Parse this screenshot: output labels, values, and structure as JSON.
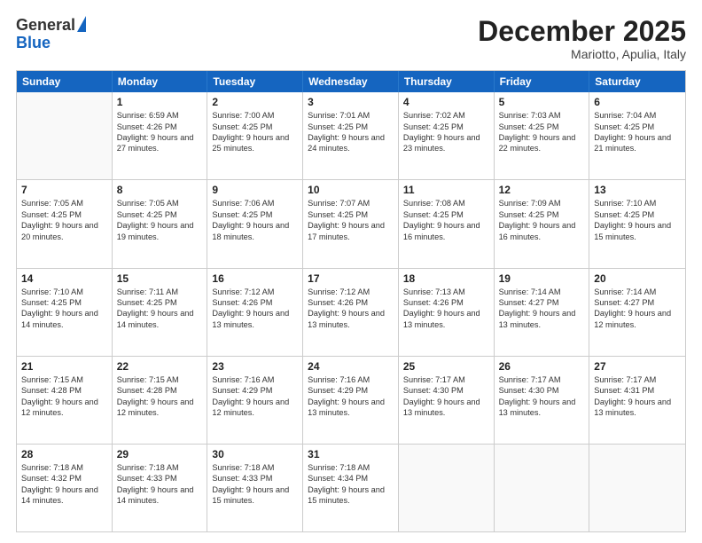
{
  "logo": {
    "general": "General",
    "blue": "Blue"
  },
  "header": {
    "month": "December 2025",
    "location": "Mariotto, Apulia, Italy"
  },
  "weekdays": [
    "Sunday",
    "Monday",
    "Tuesday",
    "Wednesday",
    "Thursday",
    "Friday",
    "Saturday"
  ],
  "rows": [
    [
      {
        "day": "",
        "sunrise": "",
        "sunset": "",
        "daylight": ""
      },
      {
        "day": "1",
        "sunrise": "Sunrise: 6:59 AM",
        "sunset": "Sunset: 4:26 PM",
        "daylight": "Daylight: 9 hours and 27 minutes."
      },
      {
        "day": "2",
        "sunrise": "Sunrise: 7:00 AM",
        "sunset": "Sunset: 4:25 PM",
        "daylight": "Daylight: 9 hours and 25 minutes."
      },
      {
        "day": "3",
        "sunrise": "Sunrise: 7:01 AM",
        "sunset": "Sunset: 4:25 PM",
        "daylight": "Daylight: 9 hours and 24 minutes."
      },
      {
        "day": "4",
        "sunrise": "Sunrise: 7:02 AM",
        "sunset": "Sunset: 4:25 PM",
        "daylight": "Daylight: 9 hours and 23 minutes."
      },
      {
        "day": "5",
        "sunrise": "Sunrise: 7:03 AM",
        "sunset": "Sunset: 4:25 PM",
        "daylight": "Daylight: 9 hours and 22 minutes."
      },
      {
        "day": "6",
        "sunrise": "Sunrise: 7:04 AM",
        "sunset": "Sunset: 4:25 PM",
        "daylight": "Daylight: 9 hours and 21 minutes."
      }
    ],
    [
      {
        "day": "7",
        "sunrise": "Sunrise: 7:05 AM",
        "sunset": "Sunset: 4:25 PM",
        "daylight": "Daylight: 9 hours and 20 minutes."
      },
      {
        "day": "8",
        "sunrise": "Sunrise: 7:05 AM",
        "sunset": "Sunset: 4:25 PM",
        "daylight": "Daylight: 9 hours and 19 minutes."
      },
      {
        "day": "9",
        "sunrise": "Sunrise: 7:06 AM",
        "sunset": "Sunset: 4:25 PM",
        "daylight": "Daylight: 9 hours and 18 minutes."
      },
      {
        "day": "10",
        "sunrise": "Sunrise: 7:07 AM",
        "sunset": "Sunset: 4:25 PM",
        "daylight": "Daylight: 9 hours and 17 minutes."
      },
      {
        "day": "11",
        "sunrise": "Sunrise: 7:08 AM",
        "sunset": "Sunset: 4:25 PM",
        "daylight": "Daylight: 9 hours and 16 minutes."
      },
      {
        "day": "12",
        "sunrise": "Sunrise: 7:09 AM",
        "sunset": "Sunset: 4:25 PM",
        "daylight": "Daylight: 9 hours and 16 minutes."
      },
      {
        "day": "13",
        "sunrise": "Sunrise: 7:10 AM",
        "sunset": "Sunset: 4:25 PM",
        "daylight": "Daylight: 9 hours and 15 minutes."
      }
    ],
    [
      {
        "day": "14",
        "sunrise": "Sunrise: 7:10 AM",
        "sunset": "Sunset: 4:25 PM",
        "daylight": "Daylight: 9 hours and 14 minutes."
      },
      {
        "day": "15",
        "sunrise": "Sunrise: 7:11 AM",
        "sunset": "Sunset: 4:25 PM",
        "daylight": "Daylight: 9 hours and 14 minutes."
      },
      {
        "day": "16",
        "sunrise": "Sunrise: 7:12 AM",
        "sunset": "Sunset: 4:26 PM",
        "daylight": "Daylight: 9 hours and 13 minutes."
      },
      {
        "day": "17",
        "sunrise": "Sunrise: 7:12 AM",
        "sunset": "Sunset: 4:26 PM",
        "daylight": "Daylight: 9 hours and 13 minutes."
      },
      {
        "day": "18",
        "sunrise": "Sunrise: 7:13 AM",
        "sunset": "Sunset: 4:26 PM",
        "daylight": "Daylight: 9 hours and 13 minutes."
      },
      {
        "day": "19",
        "sunrise": "Sunrise: 7:14 AM",
        "sunset": "Sunset: 4:27 PM",
        "daylight": "Daylight: 9 hours and 13 minutes."
      },
      {
        "day": "20",
        "sunrise": "Sunrise: 7:14 AM",
        "sunset": "Sunset: 4:27 PM",
        "daylight": "Daylight: 9 hours and 12 minutes."
      }
    ],
    [
      {
        "day": "21",
        "sunrise": "Sunrise: 7:15 AM",
        "sunset": "Sunset: 4:28 PM",
        "daylight": "Daylight: 9 hours and 12 minutes."
      },
      {
        "day": "22",
        "sunrise": "Sunrise: 7:15 AM",
        "sunset": "Sunset: 4:28 PM",
        "daylight": "Daylight: 9 hours and 12 minutes."
      },
      {
        "day": "23",
        "sunrise": "Sunrise: 7:16 AM",
        "sunset": "Sunset: 4:29 PM",
        "daylight": "Daylight: 9 hours and 12 minutes."
      },
      {
        "day": "24",
        "sunrise": "Sunrise: 7:16 AM",
        "sunset": "Sunset: 4:29 PM",
        "daylight": "Daylight: 9 hours and 13 minutes."
      },
      {
        "day": "25",
        "sunrise": "Sunrise: 7:17 AM",
        "sunset": "Sunset: 4:30 PM",
        "daylight": "Daylight: 9 hours and 13 minutes."
      },
      {
        "day": "26",
        "sunrise": "Sunrise: 7:17 AM",
        "sunset": "Sunset: 4:30 PM",
        "daylight": "Daylight: 9 hours and 13 minutes."
      },
      {
        "day": "27",
        "sunrise": "Sunrise: 7:17 AM",
        "sunset": "Sunset: 4:31 PM",
        "daylight": "Daylight: 9 hours and 13 minutes."
      }
    ],
    [
      {
        "day": "28",
        "sunrise": "Sunrise: 7:18 AM",
        "sunset": "Sunset: 4:32 PM",
        "daylight": "Daylight: 9 hours and 14 minutes."
      },
      {
        "day": "29",
        "sunrise": "Sunrise: 7:18 AM",
        "sunset": "Sunset: 4:33 PM",
        "daylight": "Daylight: 9 hours and 14 minutes."
      },
      {
        "day": "30",
        "sunrise": "Sunrise: 7:18 AM",
        "sunset": "Sunset: 4:33 PM",
        "daylight": "Daylight: 9 hours and 15 minutes."
      },
      {
        "day": "31",
        "sunrise": "Sunrise: 7:18 AM",
        "sunset": "Sunset: 4:34 PM",
        "daylight": "Daylight: 9 hours and 15 minutes."
      },
      {
        "day": "",
        "sunrise": "",
        "sunset": "",
        "daylight": ""
      },
      {
        "day": "",
        "sunrise": "",
        "sunset": "",
        "daylight": ""
      },
      {
        "day": "",
        "sunrise": "",
        "sunset": "",
        "daylight": ""
      }
    ]
  ]
}
